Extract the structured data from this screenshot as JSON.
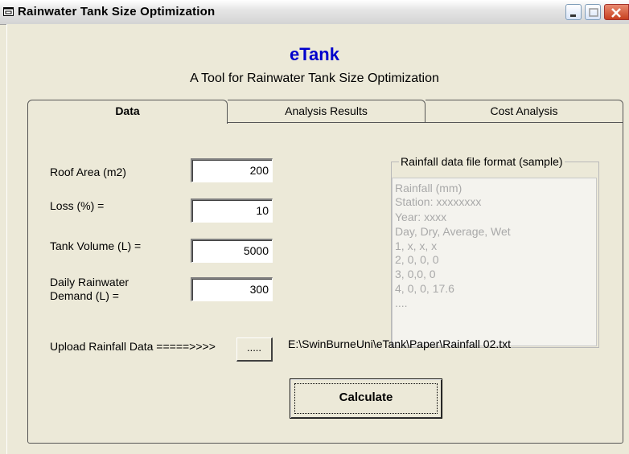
{
  "window": {
    "title": "Rainwater Tank Size Optimization"
  },
  "header": {
    "app_name": "eTank",
    "subtitle": "A Tool for Rainwater Tank Size Optimization"
  },
  "tabs": [
    {
      "label": "Data",
      "active": true
    },
    {
      "label": "Analysis Results",
      "active": false
    },
    {
      "label": "Cost Analysis",
      "active": false
    }
  ],
  "form": {
    "roof_area": {
      "label": "Roof Area (m2)",
      "value": "200"
    },
    "loss": {
      "label": "Loss (%) =",
      "value": "10"
    },
    "tank_volume": {
      "label": "Tank Volume (L) =",
      "value": "5000"
    },
    "daily_demand": {
      "label_line1": "Daily Rainwater",
      "label_line2": "Demand (L) =",
      "value": "300"
    }
  },
  "sample_format": {
    "title": "Rainfall data file format (sample)",
    "lines": [
      "Rainfall (mm)",
      "Station: xxxxxxxx",
      "Year: xxxx",
      "Day, Dry, Average, Wet",
      "1, x, x, x",
      "2, 0, 0, 0",
      "3, 0,0, 0",
      "4, 0, 0, 17.6",
      "...."
    ]
  },
  "upload": {
    "label": "Upload Rainfall Data =====>>>>",
    "browse_label": ".....",
    "file_path": "E:\\SwinBurneUni\\eTank\\Paper\\Rainfall 02.txt"
  },
  "actions": {
    "calculate_label": "Calculate"
  }
}
